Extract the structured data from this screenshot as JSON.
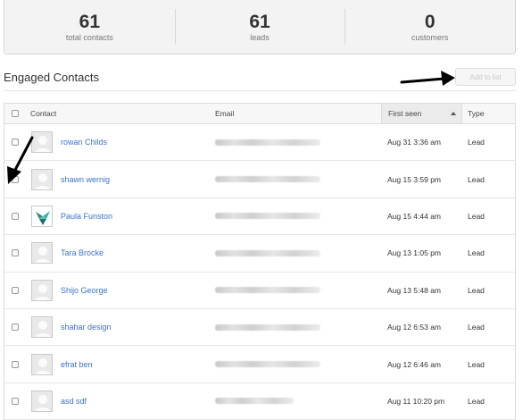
{
  "stats": [
    {
      "value": "61",
      "label": "total contacts"
    },
    {
      "value": "61",
      "label": "leads"
    },
    {
      "value": "0",
      "label": "customers"
    }
  ],
  "section": {
    "title": "Engaged Contacts",
    "add_button": "Add to list"
  },
  "table": {
    "headers": {
      "contact": "Contact",
      "email": "Email",
      "first_seen": "First seen",
      "type": "Type"
    },
    "rows": [
      {
        "name": "rowan Childs",
        "first_seen": "Aug 31 3:36 am",
        "type": "Lead",
        "avatar": "default-avatar-icon"
      },
      {
        "name": "shawn wernig",
        "first_seen": "Aug 15 3:59 pm",
        "type": "Lead",
        "avatar": "default-avatar-icon"
      },
      {
        "name": "Paula Funston",
        "first_seen": "Aug 15 4:44 am",
        "type": "Lead",
        "avatar": "origami-bird-avatar-icon"
      },
      {
        "name": "Tara Brocke",
        "first_seen": "Aug 13 1:05 pm",
        "type": "Lead",
        "avatar": "default-avatar-icon"
      },
      {
        "name": "Shijo George",
        "first_seen": "Aug 13 5:48 am",
        "type": "Lead",
        "avatar": "default-avatar-icon"
      },
      {
        "name": "shahar design",
        "first_seen": "Aug 12 6:53 am",
        "type": "Lead",
        "avatar": "default-avatar-icon"
      },
      {
        "name": "efrat ben",
        "first_seen": "Aug 12 6:46 am",
        "type": "Lead",
        "avatar": "default-avatar-icon"
      },
      {
        "name": "asd sdf",
        "first_seen": "Aug 11 10:20 pm",
        "type": "Lead",
        "avatar": "default-avatar-icon"
      }
    ]
  },
  "colors": {
    "link": "#3b73c8",
    "panel_bg": "#f3f3f3",
    "border": "#dcdcdc"
  }
}
